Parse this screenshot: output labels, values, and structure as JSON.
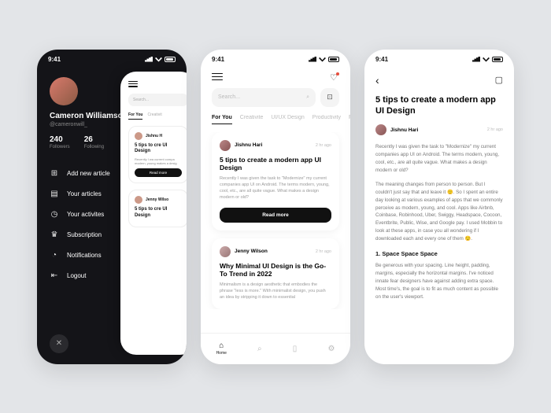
{
  "status": {
    "time": "9:41"
  },
  "drawer": {
    "name": "Cameron Williamson",
    "handle": "@cameronwill_",
    "followers_count": "240",
    "followers_label": "Followers",
    "following_count": "26",
    "following_label": "Following",
    "menu": {
      "add": "Add new article",
      "articles": "Your articles",
      "activities": "Your activites",
      "subscription": "Subscription",
      "notifications": "Notifications",
      "logout": "Logout"
    }
  },
  "peek": {
    "search_placeholder": "Search...",
    "tab1": "For You",
    "tab2": "Creativit",
    "card1": {
      "author": "Jishnu H",
      "title": "5 tips to cre UI Design",
      "body": "Recently I wa current compa modern, young makes a desig",
      "btn": "Read more"
    },
    "card2": {
      "author": "Jenny Wilso",
      "title": "5 tips to cre UI Design"
    }
  },
  "feed": {
    "search_placeholder": "Search...",
    "tabs": {
      "t1": "For You",
      "t2": "Creativite",
      "t3": "UI/UX Design",
      "t4": "Productivity",
      "t5": "F"
    },
    "card1": {
      "author": "Jishnu Hari",
      "time": "2 hr ago",
      "title": "5 tips to create a modern app UI Design",
      "excerpt": "Recently I was given the task to \"Modernize\" my current companies app UI on Android. The terms modern, young, cool, etc., are all quite vague. What makes a design modern or old?",
      "btn": "Read more"
    },
    "card2": {
      "author": "Jenny Wilson",
      "time": "2 hr ago",
      "title": "Why Minimal UI Design is the Go-To Trend in 2022",
      "excerpt": "Minimalism is a design aesthetic that embodies the phrase \"less is more.\" With minimalist design, you push an idea by stripping it down to essential"
    },
    "nav": {
      "home": "Home"
    }
  },
  "article": {
    "title": "5 tips to create a modern app UI Design",
    "author": "Jishnu Hari",
    "time": "2 hr ago",
    "p1": "Recently I was given the task to \"Modernize\" my current companies app UI on Android. The terms modern, young, cool, etc., are all quite vague. What makes a design modern or old?",
    "p2": "The meaning changes from person to person. But I couldn't just say that and leave it 🙂. So I spent an entire day looking at various examples of apps that we commonly perceive as modern, young, and cool. Apps like Airbnb, Coinbase, Robinhood, Uber, Swiggy, Headspace, Cocoon, Eventbrite, Public, Wise, and Google pay. I used Mobbin to look at these apps, in case you all wondering if I downloaded each and every one of them 😌.",
    "h1": "1. Space Space Space",
    "p3": "Be generous with your spacing. Line height, padding, margins, especially the horizontal margins. I've noticed innate fear designers have against adding extra space. Most time's, the goal is to fit as much content as possible on the user's viewport."
  }
}
